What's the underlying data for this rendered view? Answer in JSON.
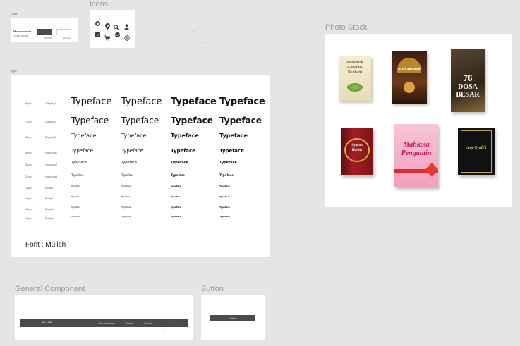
{
  "colors": {
    "label": "Color",
    "swatch_title": "Monochrome",
    "swatch_subtitle": "Grey, White",
    "hex_dark": "4B4B4B",
    "hex_light": "E6E6E6",
    "dark": "#4b4b4b",
    "light": "#ffffff"
  },
  "icons": {
    "label": "Icons",
    "items": [
      "home-icon",
      "location-pin-icon",
      "search-icon",
      "user-icon",
      "checkbox-icon",
      "cart-icon",
      "check-circle-icon",
      "dollar-icon"
    ]
  },
  "ellipsis": [
    "...",
    "..."
  ],
  "type": {
    "label": "Type",
    "font_caption": "Font : Mulish",
    "sample": "Typeface",
    "rows": [
      {
        "size": "60px",
        "name": "Display1"
      },
      {
        "size": "72px",
        "name": "Display2"
      },
      {
        "size": "40px",
        "name": "Display3"
      },
      {
        "size": "40px",
        "name": "Heading1"
      },
      {
        "size": "32px",
        "name": "Heading2"
      },
      {
        "size": "24px",
        "name": "Heading3"
      },
      {
        "size": "18px",
        "name": "Body1"
      },
      {
        "size": "16px",
        "name": "Body2"
      },
      {
        "size": "12px",
        "name": "Body3"
      },
      {
        "size": "12px",
        "name": "Body4"
      }
    ]
  },
  "photo_stock": {
    "label": "Photo Stock",
    "books": [
      {
        "title_line1": "Mencetak",
        "title_line2": "Generasi",
        "title_line3": "Rabbani"
      },
      {
        "title_line1": "Muhammad",
        "title_line2": "",
        "title_line3": ""
      },
      {
        "title_line1": "76",
        "title_line2": "DOSA",
        "title_line3": "BESAR"
      },
      {
        "title_line1": "Syarah",
        "title_line2": "Hadits",
        "title_line3": ""
      },
      {
        "title_line1": "Mahkota",
        "title_line2": "Pengantin",
        "title_line3": ""
      },
      {
        "title_line1": "Asy-Syafi'i",
        "title_line2": "",
        "title_line3": ""
      }
    ]
  },
  "general_component": {
    "label": "General Component",
    "logo": "حسنة",
    "nav": [
      "Merchandise",
      "Kitab",
      "Produk"
    ]
  },
  "button": {
    "label": "Button",
    "text": "Button"
  }
}
